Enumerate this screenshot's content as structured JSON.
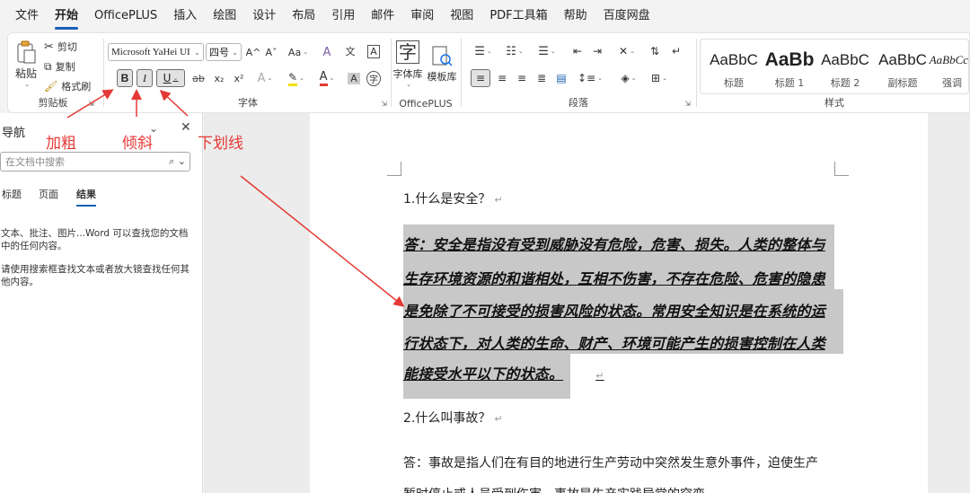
{
  "menu": [
    "文件",
    "开始",
    "OfficePLUS",
    "插入",
    "绘图",
    "设计",
    "布局",
    "引用",
    "邮件",
    "审阅",
    "视图",
    "PDF工具箱",
    "帮助",
    "百度网盘"
  ],
  "ribbon": {
    "clipboard": {
      "paste": "粘贴",
      "cut": "剪切",
      "copy": "复制",
      "format_painter": "格式刷",
      "label": "剪贴板"
    },
    "font": {
      "font_name": "Microsoft YaHei UI",
      "font_size": "四号",
      "grow": "A^",
      "shrink": "Aˇ",
      "case": "Aa",
      "bold": "B",
      "italic": "I",
      "underline": "U",
      "strike": "ab",
      "sub": "x₂",
      "sup": "x²",
      "label": "字体"
    },
    "officeplus": {
      "font_lib": "字体库",
      "template_lib": "模板库",
      "label": "OfficePLUS"
    },
    "paragraph": {
      "label": "段落"
    },
    "styles": {
      "items": [
        {
          "sample": "AaBbC",
          "name": "标题"
        },
        {
          "sample": "AaBb",
          "name": "标题 1"
        },
        {
          "sample": "AaBbC",
          "name": "标题 2"
        },
        {
          "sample": "AaBbC",
          "name": "副标题"
        },
        {
          "sample": "AaBbCcL",
          "name": "强调"
        }
      ],
      "label": "样式"
    }
  },
  "nav": {
    "title": "导航",
    "search_placeholder": "在文档中搜索",
    "tabs": [
      "标题",
      "页面",
      "结果"
    ],
    "info1": "文本、批注、图片...Word 可以查找您的文档中的任何内容。",
    "info2": "请使用搜索框查找文本或者放大镜查找任何其他内容。"
  },
  "annotations": {
    "bold": "加粗",
    "italic": "倾斜",
    "underline": "下划线"
  },
  "document": {
    "q1": "1.什么是安全？",
    "a1_lines": [
      "答：安全是指没有受到威胁没有危险，危害、损失。人类的整体与",
      "生存环境资源的和谐相处，互相不伤害，不存在危险、危害的隐患",
      "是免除了不可接受的损害风险的状态。常用安全知识是在系统的运",
      "行状态下，对人类的生命、财产、环境可能产生的损害控制在人类",
      "能接受水平以下的状态。"
    ],
    "q2": "2.什么叫事故？",
    "a2_line1": "答：事故是指人们在有目的地进行生产劳动中突然发生意外事件，迫使生产",
    "a2_line2": "暂时停止或人员受到伤害。事故是生产实践导常的突变"
  },
  "colors": {
    "accent": "#1a5fb4",
    "annotation": "#e53935",
    "highlight": "#c8c8c8"
  }
}
